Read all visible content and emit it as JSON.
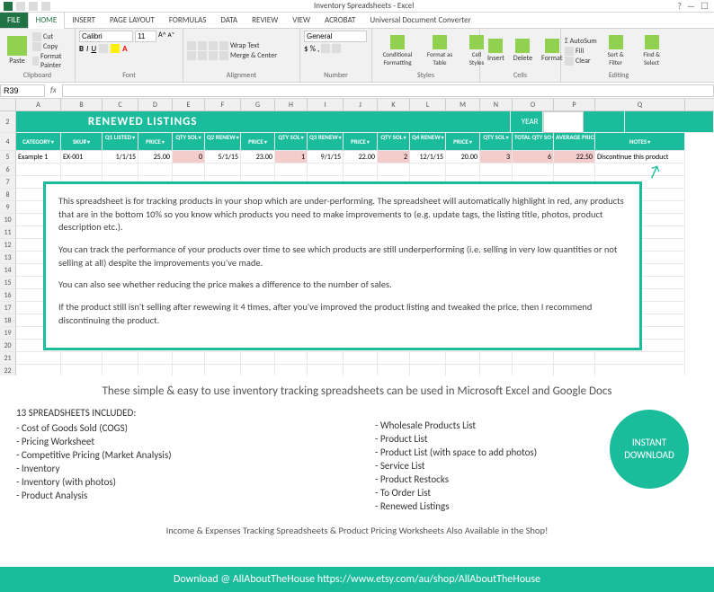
{
  "app": {
    "title": "Inventory Spreadsheets - Excel",
    "help_icon": "?",
    "min_icon": "—",
    "window_icon": "☐"
  },
  "tabs": {
    "file": "FILE",
    "home": "HOME",
    "insert": "INSERT",
    "page_layout": "PAGE LAYOUT",
    "formulas": "FORMULAS",
    "data": "DATA",
    "review": "REVIEW",
    "view": "VIEW",
    "acrobat": "ACROBAT",
    "udc": "Universal Document Converter"
  },
  "ribbon": {
    "clipboard": {
      "label": "Clipboard",
      "paste": "Paste",
      "cut": "Cut",
      "copy": "Copy",
      "painter": "Format Painter"
    },
    "font": {
      "label": "Font",
      "name": "Calibri",
      "size": "11"
    },
    "alignment": {
      "label": "Alignment",
      "wrap": "Wrap Text",
      "merge": "Merge & Center"
    },
    "number": {
      "label": "Number",
      "format": "General"
    },
    "styles": {
      "label": "Styles",
      "cond": "Conditional Formatting",
      "table": "Format as Table",
      "cell": "Cell Styles"
    },
    "cells": {
      "label": "Cells",
      "insert": "Insert",
      "delete": "Delete",
      "format": "Format"
    },
    "editing": {
      "label": "Editing",
      "autosum": "AutoSum",
      "fill": "Fill",
      "clear": "Clear",
      "sort": "Sort & Filter",
      "find": "Find & Select"
    }
  },
  "formula": {
    "namebox": "R39",
    "fx": "fx",
    "value": ""
  },
  "cols": [
    "A",
    "B",
    "C",
    "D",
    "E",
    "F",
    "G",
    "H",
    "I",
    "J",
    "K",
    "L",
    "M",
    "N",
    "O",
    "P",
    "Q"
  ],
  "banner": {
    "title": "RENEWED LISTINGS",
    "year_label": "YEAR"
  },
  "headers": {
    "category": "CATEGORY",
    "sku": "SKU#",
    "q1_listed": "Q1 LISTED",
    "q1_price": "PRICE",
    "q1_qty": "QTY SOL",
    "q2_renew": "Q2 RENEW",
    "q2_price": "PRICE",
    "q2_qty": "QTY SOL",
    "q3_renew": "Q3 RENEW",
    "q3_price": "PRICE",
    "q3_qty": "QTY SOL",
    "q4_renew": "Q4 RENEW",
    "q4_price": "PRICE",
    "q4_qty": "QTY SOL",
    "total_qty": "TOTAL QTY SO",
    "avg_price": "AVERAGE PRICE",
    "notes": "NOTES"
  },
  "datarow": {
    "category": "Example 1",
    "sku": "EX-001",
    "q1_listed": "1/1/15",
    "q1_price": "25.00",
    "q1_qty": "0",
    "q2_renew": "5/1/15",
    "q2_price": "23.00",
    "q2_qty": "1",
    "q3_renew": "9/1/15",
    "q3_price": "22.00",
    "q3_qty": "2",
    "q4_renew": "12/1/15",
    "q4_price": "20.00",
    "q4_qty": "3",
    "total_qty": "6",
    "avg_price": "22.50",
    "notes": "Discontinue this product"
  },
  "description": {
    "p1": "This spreadsheet is for tracking products in your shop which are under-performing.  The spreadsheet will automatically highlight in red, any products that are in the bottom 10% so you know which products you need to make improvements to (e.g. update tags, the listing title, photos, product description etc.).",
    "p2": "You can track the performance of your products over time to see which products are still underperforming (i.e. selling in very low quantities or not selling at all) despite the improvements you've made.",
    "p3": "You can also see whether reducing the price makes a difference to the number of sales.",
    "p4": "If the product still isn't selling after rewewing it 4 times, after you've improved the product listing and tweaked the price, then I recommend discontinuing the product."
  },
  "marketing": {
    "headline": "These simple & easy to use inventory tracking spreadsheets can be used in Microsoft Excel and Google Docs",
    "col1_title": "13 SPREADSHEETS INCLUDED:",
    "col1": [
      "- Cost of Goods Sold (COGS)",
      "- Pricing Worksheet",
      "- Competitive Pricing (Market Analysis)",
      "- Inventory",
      "- Inventory (with photos)",
      "- Product Analysis"
    ],
    "col2": [
      "- Wholesale Products List",
      "- Product List",
      "- Product List (with space to add photos)",
      "- Service List",
      "- Product Restocks",
      "- To Order List",
      "- Renewed Listings"
    ],
    "badge1": "INSTANT",
    "badge2": "DOWNLOAD",
    "sub": "Income & Expenses Tracking Spreadsheets & Product Pricing Worksheets Also Available in the Shop!"
  },
  "footer": {
    "text": "Download @ AllAboutTheHouse   https://www.etsy.com/au/shop/AllAboutTheHouse"
  }
}
